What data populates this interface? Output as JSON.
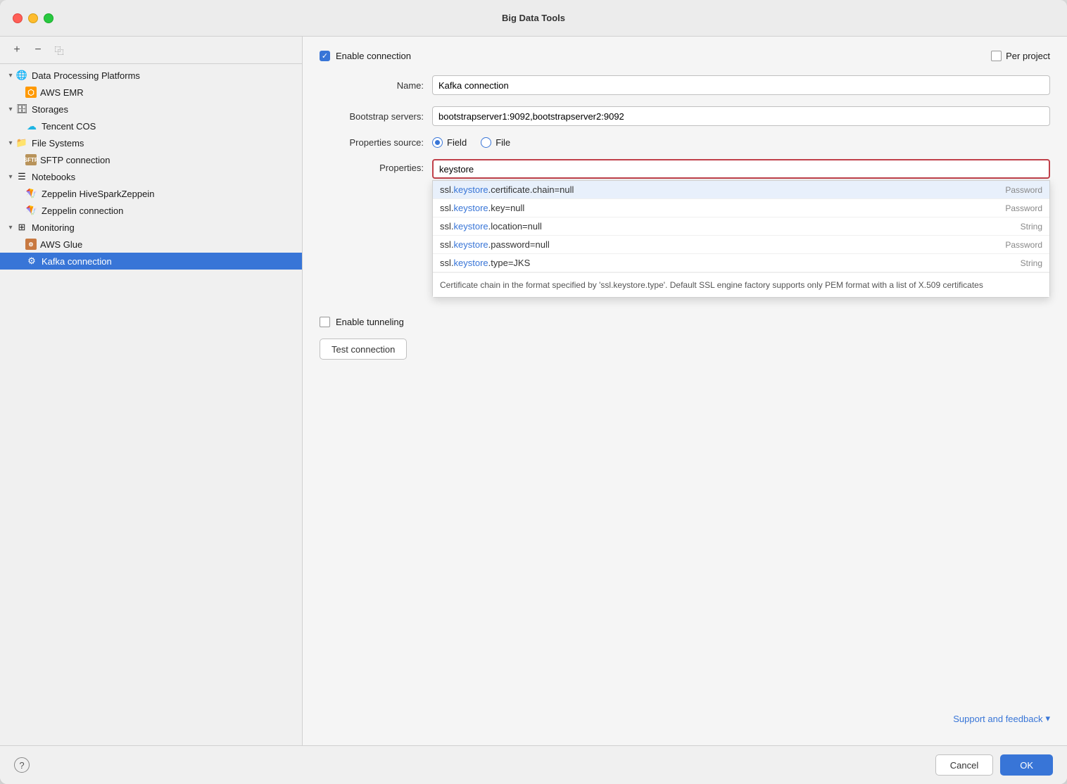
{
  "window": {
    "title": "Big Data Tools"
  },
  "sidebar": {
    "toolbar": {
      "add_label": "+",
      "remove_label": "−",
      "copy_label": "⿻"
    },
    "tree": [
      {
        "id": "data-processing-platforms",
        "level": 0,
        "expanded": true,
        "icon": "globe",
        "label": "Data Processing Platforms"
      },
      {
        "id": "aws-emr",
        "level": 1,
        "expanded": false,
        "icon": "aws",
        "label": "AWS EMR"
      },
      {
        "id": "storages",
        "level": 0,
        "expanded": true,
        "icon": "storage",
        "label": "Storages"
      },
      {
        "id": "tencent-cos",
        "level": 1,
        "expanded": false,
        "icon": "tencent",
        "label": "Tencent COS"
      },
      {
        "id": "file-systems",
        "level": 0,
        "expanded": true,
        "icon": "folder",
        "label": "File Systems"
      },
      {
        "id": "sftp-connection",
        "level": 1,
        "expanded": false,
        "icon": "sftp",
        "label": "SFTP connection"
      },
      {
        "id": "notebooks",
        "level": 0,
        "expanded": true,
        "icon": "notebook",
        "label": "Notebooks"
      },
      {
        "id": "zeppelin-hive",
        "level": 1,
        "expanded": false,
        "icon": "zeppelin",
        "label": "Zeppelin HiveSparkZeppein"
      },
      {
        "id": "zeppelin-connection",
        "level": 1,
        "expanded": false,
        "icon": "zeppelin",
        "label": "Zeppelin connection"
      },
      {
        "id": "monitoring",
        "level": 0,
        "expanded": true,
        "icon": "monitor",
        "label": "Monitoring"
      },
      {
        "id": "aws-glue",
        "level": 1,
        "expanded": false,
        "icon": "glue",
        "label": "AWS Glue"
      },
      {
        "id": "kafka-connection",
        "level": 1,
        "expanded": false,
        "icon": "kafka",
        "label": "Kafka connection",
        "selected": true
      }
    ]
  },
  "form": {
    "enable_connection_label": "Enable connection",
    "per_project_label": "Per project",
    "name_label": "Name:",
    "name_value": "Kafka connection",
    "bootstrap_label": "Bootstrap servers:",
    "bootstrap_value": "bootstrapserver1:9092,bootstrapserver2:9092",
    "properties_source_label": "Properties source:",
    "radio_field": "Field",
    "radio_file": "File",
    "properties_label": "Properties:",
    "properties_value": "keystore",
    "enable_tunneling_label": "Enable tunneling",
    "test_connection_label": "Test connection"
  },
  "autocomplete": {
    "items": [
      {
        "prefix": "ssl.",
        "highlight": "keystore",
        "middle": ".certificate.chain=",
        "suffix": "null",
        "type": "Password"
      },
      {
        "prefix": "ssl.",
        "highlight": "keystore",
        "middle": ".key=",
        "suffix": "null",
        "type": "Password"
      },
      {
        "prefix": "ssl.",
        "highlight": "keystore",
        "middle": ".location=",
        "suffix": "null",
        "type": "String"
      },
      {
        "prefix": "ssl.",
        "highlight": "keystore",
        "middle": ".password=",
        "suffix": "null",
        "type": "Password"
      },
      {
        "prefix": "ssl.",
        "highlight": "keystore",
        "middle": ".type=",
        "suffix": "JKS",
        "type": "String"
      }
    ],
    "description": "Certificate chain in the format specified by 'ssl.keystore.type'. Default SSL engine factory supports only PEM format with a list of X.509 certificates"
  },
  "bottom_bar": {
    "help_label": "?",
    "support_feedback_label": "Support and feedback",
    "cancel_label": "Cancel",
    "ok_label": "OK"
  }
}
